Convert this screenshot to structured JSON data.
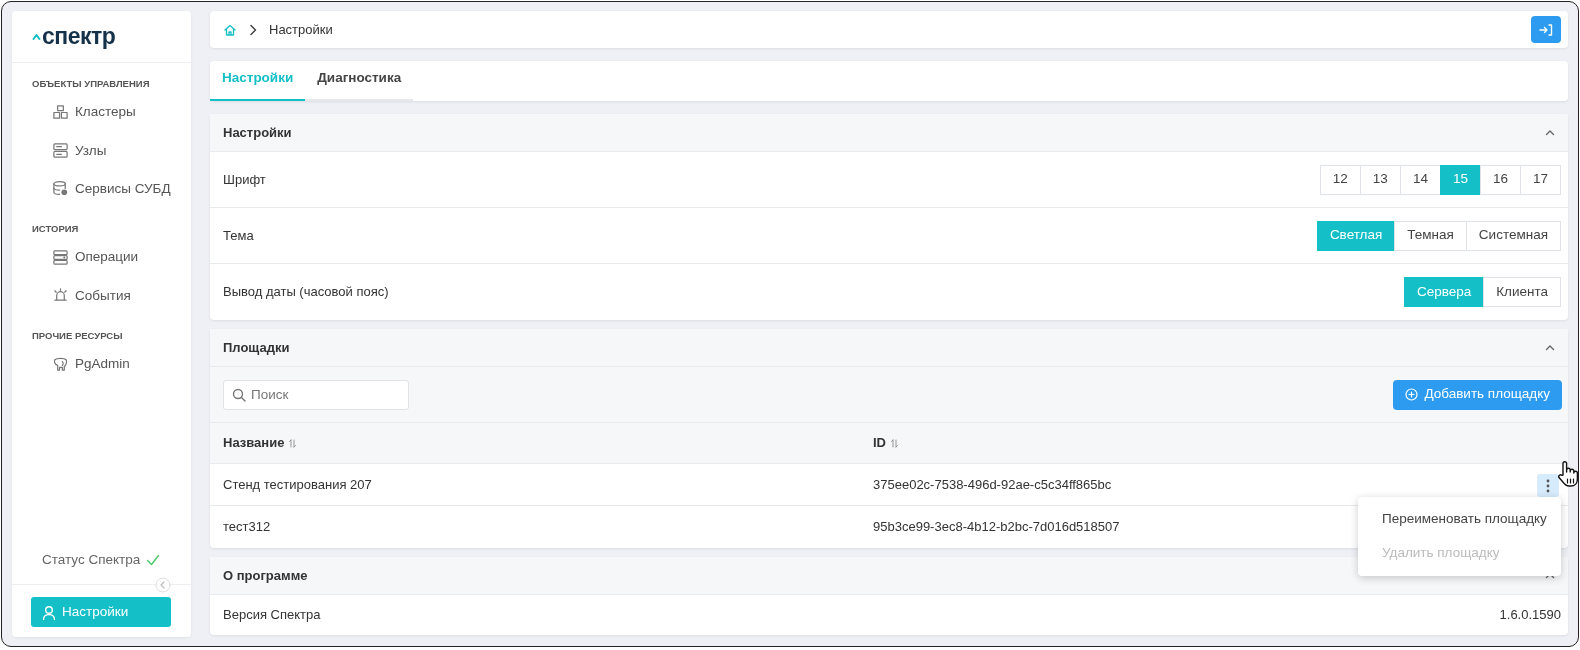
{
  "logo": {
    "text": "спектр"
  },
  "sidebar": {
    "groups": [
      {
        "title": "ОБЪЕКТЫ УПРАВЛЕНИЯ",
        "items": [
          {
            "label": "Кластеры"
          },
          {
            "label": "Узлы"
          },
          {
            "label": "Сервисы СУБД"
          }
        ]
      },
      {
        "title": "ИСТОРИЯ",
        "items": [
          {
            "label": "Операции"
          },
          {
            "label": "События"
          }
        ]
      },
      {
        "title": "ПРОЧИЕ РЕСУРСЫ",
        "items": [
          {
            "label": "PgAdmin"
          }
        ]
      }
    ],
    "status": {
      "label": "Статус Спектра",
      "ok": true
    },
    "user_button": "Настройки"
  },
  "breadcrumb": [
    "Настройки"
  ],
  "tabs": [
    {
      "label": "Настройки",
      "selected": true
    },
    {
      "label": "Диагностика",
      "selected": false
    }
  ],
  "settings": {
    "title": "Настройки",
    "expanded": true,
    "rows": [
      {
        "label": "Шрифт",
        "options": [
          {
            "label": "12",
            "selected": false
          },
          {
            "label": "13",
            "selected": false
          },
          {
            "label": "14",
            "selected": false
          },
          {
            "label": "15",
            "selected": true
          },
          {
            "label": "16",
            "selected": false
          },
          {
            "label": "17",
            "selected": false
          }
        ]
      },
      {
        "label": "Тема",
        "options": [
          {
            "label": "Светлая",
            "selected": true
          },
          {
            "label": "Темная",
            "selected": false
          },
          {
            "label": "Системная",
            "selected": false
          }
        ]
      },
      {
        "label": "Вывод даты (часовой пояс)",
        "options": [
          {
            "label": "Сервера",
            "selected": true
          },
          {
            "label": "Клиента",
            "selected": false
          }
        ]
      }
    ]
  },
  "sites": {
    "title": "Площадки",
    "expanded": true,
    "search": {
      "placeholder": "Поиск"
    },
    "add_button": "Добавить площадку",
    "columns": [
      "Название",
      "ID"
    ],
    "rows": [
      {
        "cells": [
          "Стенд тестирования 207",
          "375ee02c-7538-496d-92ae-c5c34ff865bc"
        ],
        "menu_open": true
      },
      {
        "cells": [
          "тест312",
          "95b3ce99-3ec8-4b12-b2bc-7d016d518507"
        ],
        "menu_open": false
      }
    ],
    "row_menu": [
      {
        "label": "Переименовать площадку",
        "disabled": false
      },
      {
        "label": "Удалить площадку",
        "disabled": true
      }
    ]
  },
  "about": {
    "title": "О программе",
    "expanded": true,
    "rows": [
      {
        "label": "Версия Спектра",
        "value": "1.6.0.1590"
      }
    ]
  }
}
